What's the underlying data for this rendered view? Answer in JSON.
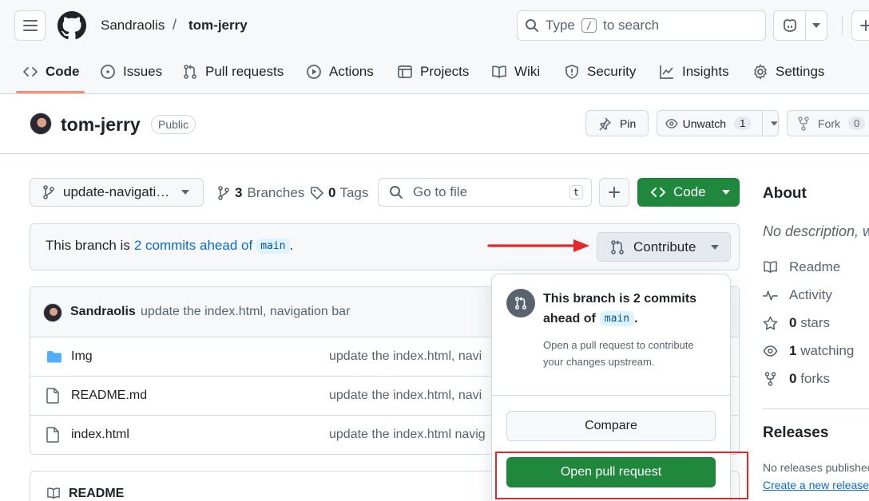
{
  "header": {
    "owner": "Sandraolis",
    "separator": "/",
    "repo": "tom-jerry",
    "search_prefix": "Type",
    "search_key": "/",
    "search_suffix": "to search"
  },
  "tabs": [
    {
      "label": "Code"
    },
    {
      "label": "Issues"
    },
    {
      "label": "Pull requests"
    },
    {
      "label": "Actions"
    },
    {
      "label": "Projects"
    },
    {
      "label": "Wiki"
    },
    {
      "label": "Security"
    },
    {
      "label": "Insights"
    },
    {
      "label": "Settings"
    }
  ],
  "repo_header": {
    "name": "tom-jerry",
    "visibility": "Public",
    "pin": "Pin",
    "unwatch": "Unwatch",
    "watch_count": "1",
    "fork": "Fork",
    "fork_count": "0"
  },
  "toolbar": {
    "branch": "update-navigati…",
    "branches_count": "3",
    "branches_label": "Branches",
    "tags_count": "0",
    "tags_label": "Tags",
    "goto_placeholder": "Go to file",
    "goto_key": "t",
    "code_label": "Code"
  },
  "branch_status": {
    "prefix": "This branch is",
    "link": "2 commits ahead of",
    "base": "main",
    "suffix": ".",
    "contribute": "Contribute"
  },
  "commit": {
    "author": "Sandraolis",
    "message": "update the index.html, navigation bar"
  },
  "files": [
    {
      "name": "Img",
      "type": "folder",
      "message": "update the index.html, navi"
    },
    {
      "name": "README.md",
      "type": "file",
      "message": "update the index.html, navi"
    },
    {
      "name": "index.html",
      "type": "file",
      "message": "update the index.html navig"
    }
  ],
  "readme": {
    "label": "README"
  },
  "popup": {
    "title_line1": "This branch is 2 commits",
    "title_line2": "ahead of",
    "base": "main",
    "title_end": ".",
    "desc_line1": "Open a pull request to contribute",
    "desc_line2": "your changes upstream.",
    "compare": "Compare",
    "open_pr": "Open pull request"
  },
  "about": {
    "title": "About",
    "description": "No description, w",
    "readme": "Readme",
    "activity": "Activity",
    "stars_count": "0",
    "stars_label": "stars",
    "watching_count": "1",
    "watching_label": "watching",
    "forks_count": "0",
    "forks_label": "forks"
  },
  "releases": {
    "title": "Releases",
    "none": "No releases publishec",
    "create": "Create a new release"
  },
  "colors": {
    "accent": "#0969da",
    "green": "#1f883d",
    "annotation_red": "#e5262b",
    "tab_underline": "#fd8c73"
  }
}
